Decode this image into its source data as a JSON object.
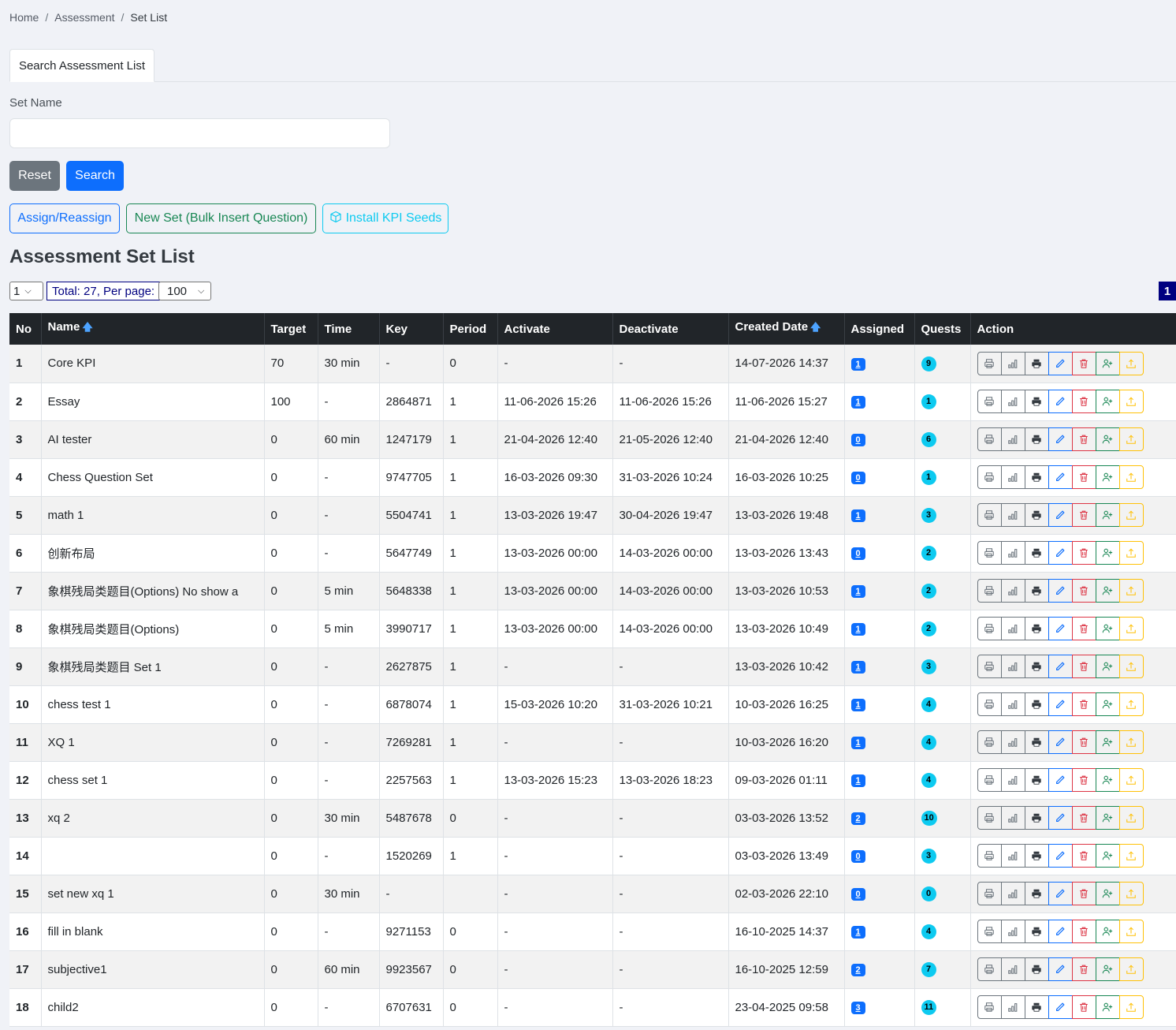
{
  "breadcrumb": {
    "home": "Home",
    "assessment": "Assessment",
    "current": "Set List",
    "sep": "/"
  },
  "tab": {
    "label": "Search Assessment List"
  },
  "search": {
    "label": "Set Name",
    "value": "",
    "placeholder": ""
  },
  "buttons": {
    "reset": "Reset",
    "search": "Search",
    "assign": "Assign/Reassign",
    "new_set": "New Set (Bulk Insert Question)",
    "install_kpi": "Install KPI Seeds"
  },
  "title": "Assessment Set List",
  "pager": {
    "page_select": "1",
    "total_text": "Total: 27, Per page:",
    "per_page": "100",
    "current_page": "1"
  },
  "columns": {
    "no": "No",
    "name": "Name",
    "target": "Target",
    "time": "Time",
    "key": "Key",
    "period": "Period",
    "activate": "Activate",
    "deactivate": "Deactivate",
    "created": "Created Date",
    "assigned": "Assigned",
    "quests": "Quests",
    "action": "Action"
  },
  "icons": {
    "sort": "sort-up-icon"
  },
  "rows": [
    {
      "no": "1",
      "name": "Core KPI",
      "target": "70",
      "time": "30 min",
      "key": "-",
      "period": "0",
      "activate": "-",
      "deactivate": "-",
      "created": "14-07-2026 14:37",
      "assigned": "1",
      "quests": "9"
    },
    {
      "no": "2",
      "name": "Essay",
      "target": "100",
      "time": "-",
      "key": "2864871",
      "period": "1",
      "activate": "11-06-2026 15:26",
      "deactivate": "11-06-2026 15:26",
      "created": "11-06-2026 15:27",
      "assigned": "1",
      "quests": "1"
    },
    {
      "no": "3",
      "name": "AI tester",
      "target": "0",
      "time": "60 min",
      "key": "1247179",
      "period": "1",
      "activate": "21-04-2026 12:40",
      "deactivate": "21-05-2026 12:40",
      "created": "21-04-2026 12:40",
      "assigned": "0",
      "quests": "6"
    },
    {
      "no": "4",
      "name": "Chess Question Set",
      "target": "0",
      "time": "-",
      "key": "9747705",
      "period": "1",
      "activate": "16-03-2026 09:30",
      "deactivate": "31-03-2026 10:24",
      "created": "16-03-2026 10:25",
      "assigned": "0",
      "quests": "1"
    },
    {
      "no": "5",
      "name": "math 1",
      "target": "0",
      "time": "-",
      "key": "5504741",
      "period": "1",
      "activate": "13-03-2026 19:47",
      "deactivate": "30-04-2026 19:47",
      "created": "13-03-2026 19:48",
      "assigned": "1",
      "quests": "3"
    },
    {
      "no": "6",
      "name": "创新布局",
      "target": "0",
      "time": "-",
      "key": "5647749",
      "period": "1",
      "activate": "13-03-2026 00:00",
      "deactivate": "14-03-2026 00:00",
      "created": "13-03-2026 13:43",
      "assigned": "0",
      "quests": "2"
    },
    {
      "no": "7",
      "name": "象棋残局类题目(Options) No show a",
      "target": "0",
      "time": "5 min",
      "key": "5648338",
      "period": "1",
      "activate": "13-03-2026 00:00",
      "deactivate": "14-03-2026 00:00",
      "created": "13-03-2026 10:53",
      "assigned": "1",
      "quests": "2"
    },
    {
      "no": "8",
      "name": "象棋残局类题目(Options)",
      "target": "0",
      "time": "5 min",
      "key": "3990717",
      "period": "1",
      "activate": "13-03-2026 00:00",
      "deactivate": "14-03-2026 00:00",
      "created": "13-03-2026 10:49",
      "assigned": "1",
      "quests": "2"
    },
    {
      "no": "9",
      "name": "象棋残局类题目 Set 1",
      "target": "0",
      "time": "-",
      "key": "2627875",
      "period": "1",
      "activate": "-",
      "deactivate": "-",
      "created": "13-03-2026 10:42",
      "assigned": "1",
      "quests": "3"
    },
    {
      "no": "10",
      "name": "chess test 1",
      "target": "0",
      "time": "-",
      "key": "6878074",
      "period": "1",
      "activate": "15-03-2026 10:20",
      "deactivate": "31-03-2026 10:21",
      "created": "10-03-2026 16:25",
      "assigned": "1",
      "quests": "4"
    },
    {
      "no": "11",
      "name": "XQ 1",
      "target": "0",
      "time": "-",
      "key": "7269281",
      "period": "1",
      "activate": "-",
      "deactivate": "-",
      "created": "10-03-2026 16:20",
      "assigned": "1",
      "quests": "4"
    },
    {
      "no": "12",
      "name": "chess set 1",
      "target": "0",
      "time": "-",
      "key": "2257563",
      "period": "1",
      "activate": "13-03-2026 15:23",
      "deactivate": "13-03-2026 18:23",
      "created": "09-03-2026 01:11",
      "assigned": "1",
      "quests": "4"
    },
    {
      "no": "13",
      "name": "xq 2",
      "target": "0",
      "time": "30 min",
      "key": "5487678",
      "period": "0",
      "activate": "-",
      "deactivate": "-",
      "created": "03-03-2026 13:52",
      "assigned": "2",
      "quests": "10"
    },
    {
      "no": "14",
      "name": "",
      "target": "0",
      "time": "-",
      "key": "1520269",
      "period": "1",
      "activate": "-",
      "deactivate": "-",
      "created": "03-03-2026 13:49",
      "assigned": "0",
      "quests": "3"
    },
    {
      "no": "15",
      "name": "set new xq 1",
      "target": "0",
      "time": "30 min",
      "key": "-",
      "period": "",
      "activate": "-",
      "deactivate": "-",
      "created": "02-03-2026 22:10",
      "assigned": "0",
      "quests": "0"
    },
    {
      "no": "16",
      "name": "fill in blank",
      "target": "0",
      "time": "-",
      "key": "9271153",
      "period": "0",
      "activate": "-",
      "deactivate": "-",
      "created": "16-10-2025 14:37",
      "assigned": "1",
      "quests": "4"
    },
    {
      "no": "17",
      "name": "subjective1",
      "target": "0",
      "time": "60 min",
      "key": "9923567",
      "period": "0",
      "activate": "-",
      "deactivate": "-",
      "created": "16-10-2025 12:59",
      "assigned": "2",
      "quests": "7"
    },
    {
      "no": "18",
      "name": "child2",
      "target": "0",
      "time": "-",
      "key": "6707631",
      "period": "0",
      "activate": "-",
      "deactivate": "-",
      "created": "23-04-2025 09:58",
      "assigned": "3",
      "quests": "11"
    }
  ],
  "row_actions": [
    {
      "icon": "print-outline-icon",
      "style": "a-sec"
    },
    {
      "icon": "bar-chart-icon",
      "style": "a-sec"
    },
    {
      "icon": "printer-icon",
      "style": "a-dark"
    },
    {
      "icon": "pencil-icon",
      "style": "a-pri"
    },
    {
      "icon": "trash-icon",
      "style": "a-dan"
    },
    {
      "icon": "person-add-icon",
      "style": "a-suc"
    },
    {
      "icon": "upload-icon",
      "style": "a-war"
    }
  ]
}
